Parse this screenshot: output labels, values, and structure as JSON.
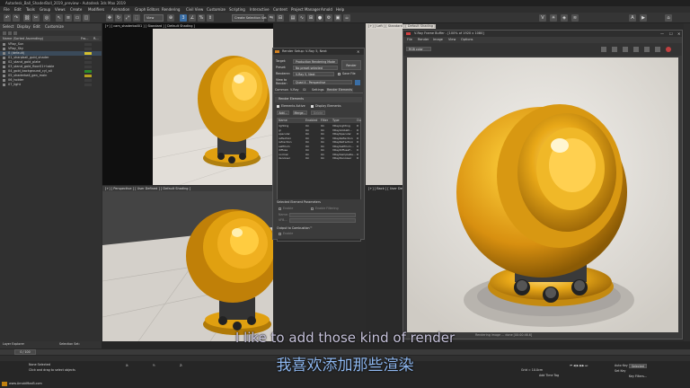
{
  "app": {
    "title": "Autodesk_Ball_ShaderBall_2019_preview - Autodesk 3ds Max 2019"
  },
  "menu": [
    "File",
    "Edit",
    "Tools",
    "Group",
    "Views",
    "Create",
    "Modifiers",
    "Animation",
    "Graph Editors",
    "Rendering",
    "Civil View",
    "Customize",
    "Scripting",
    "Interactive",
    "Content",
    "Project Manager",
    "Arnold",
    "Help"
  ],
  "toolbar": {
    "selection_set": "Create Selection Set",
    "view": "View"
  },
  "scene_explorer": {
    "tabs": [
      "Select",
      "Display",
      "Edit",
      "Customize"
    ],
    "header": "Name (Sorted Ascending)",
    "col2": "Fro...",
    "col3": "R...",
    "items": [
      {
        "name": "VRay_Sun",
        "color": "#3c3c3c"
      },
      {
        "name": "VRay_Sky",
        "color": "#3c3c3c"
      },
      {
        "name": "0 (default)",
        "color": "#d4c030"
      },
      {
        "name": "01_sharpball_gold_shader",
        "color": "#3c3c3c"
      },
      {
        "name": "02_stand_gold_plate",
        "color": "#3c3c3c"
      },
      {
        "name": "03_stand_gold_floor01+table",
        "color": "#3c3c3c"
      },
      {
        "name": "04_gold_background_cyl_all",
        "color": "#2a8a2a"
      },
      {
        "name": "05_shaderball_gen_main",
        "color": "#b8a020"
      },
      {
        "name": "06_holder",
        "color": "#3c3c3c"
      },
      {
        "name": "07_light",
        "color": "#3c3c3c"
      }
    ]
  },
  "viewports": {
    "top_left": "[+] [ cam_shaderball01 ] [ Standard ] [ Default Shading ]",
    "top_right": "[+] [ Left ] [ Standard ] [ Default Shading ]",
    "bottom_left": "[+] [ Perspective ] [ User Defined ] [ Default Shading ]",
    "bottom_right": "[+] [ Back ] [ User Defined ] [ Default Shading ]"
  },
  "render_setup": {
    "title": "Render Setup: V-Ray 5, Next",
    "target_label": "Target:",
    "target": "Production Rendering Mode",
    "preset_label": "Preset:",
    "preset": "No preset selected",
    "renderer_label": "Renderer:",
    "renderer": "V-Ray 5, Next",
    "save_file": "Save File",
    "view_label": "View to Render:",
    "view": "Quad 4 - Perspective",
    "render_button": "Render",
    "tabs": [
      "Common",
      "V-Ray",
      "GI",
      "Settings",
      "Render Elements"
    ],
    "rollout": "Render Elements",
    "elements_active": "Elements Active",
    "display_elements": "Display Elements",
    "add_btn": "Add...",
    "merge_btn": "Merge...",
    "delete_btn": "Delete",
    "columns": [
      "Name",
      "Enabled",
      "Filter",
      "Type",
      "Ou"
    ],
    "rows": [
      {
        "name": "lighting",
        "enabled": "On",
        "filter": "On",
        "type": "VRayLighting",
        "out": "D"
      },
      {
        "name": "gi",
        "enabled": "On",
        "filter": "On",
        "type": "VRayGlobalIl...",
        "out": "D"
      },
      {
        "name": "specular",
        "enabled": "On",
        "filter": "On",
        "type": "VRaySpecular",
        "out": "D"
      },
      {
        "name": "reflection",
        "enabled": "On",
        "filter": "On",
        "type": "VRayReflection",
        "out": "D"
      },
      {
        "name": "refraction",
        "enabled": "On",
        "filter": "On",
        "type": "VRayRefraction",
        "out": "D"
      },
      {
        "name": "selfIllum",
        "enabled": "On",
        "filter": "On",
        "type": "VRaySelfIllum...",
        "out": "D"
      },
      {
        "name": "diffuse",
        "enabled": "On",
        "filter": "On",
        "type": "VRayDiffuseF...",
        "out": "D"
      },
      {
        "name": "normal",
        "enabled": "On",
        "filter": "On",
        "type": "VRaySampleRa...",
        "out": "D"
      },
      {
        "name": "denoiser",
        "enabled": "On",
        "filter": "On",
        "type": "VRayDenoiser",
        "out": "D"
      }
    ],
    "selected_params": "Selected Element Parameters",
    "enable": "Enable",
    "enable_filtering": "Enable Filtering",
    "name_label": "Name:",
    "vfb_label": "VFB...",
    "output_combustion": "Output to Combustion™",
    "enable2": "Enable"
  },
  "vfb": {
    "title": "V-Ray Frame Buffer - [100% of 1920 x 1080]",
    "menu": [
      "File",
      "Render",
      "Image",
      "View",
      "Options"
    ],
    "channel": "RGB color",
    "status": "Rendering image ... done [00:00:46.6]"
  },
  "subtitle": {
    "en": "I like to add those kind of render",
    "zh": "我喜欢添加那些渲染"
  },
  "status": {
    "layer": "Layer Explorer",
    "selection": "Selection Set:",
    "range": "0 / 100",
    "selected": "None Selected",
    "hint": "Click and drag to select objects",
    "x": "X:",
    "y": "Y:",
    "z": "Z:",
    "grid": "Grid = 10.0cm",
    "add_time_tag": "Add Time Tag",
    "autokey": "Auto Key",
    "setkey": "Set Key",
    "selected_mode": "Selected",
    "key_filters": "Key Filters...",
    "website": "www.ArnoldMaxB.com"
  },
  "colors": {
    "gold": "#e0a010",
    "scene_bg": "#303030"
  }
}
